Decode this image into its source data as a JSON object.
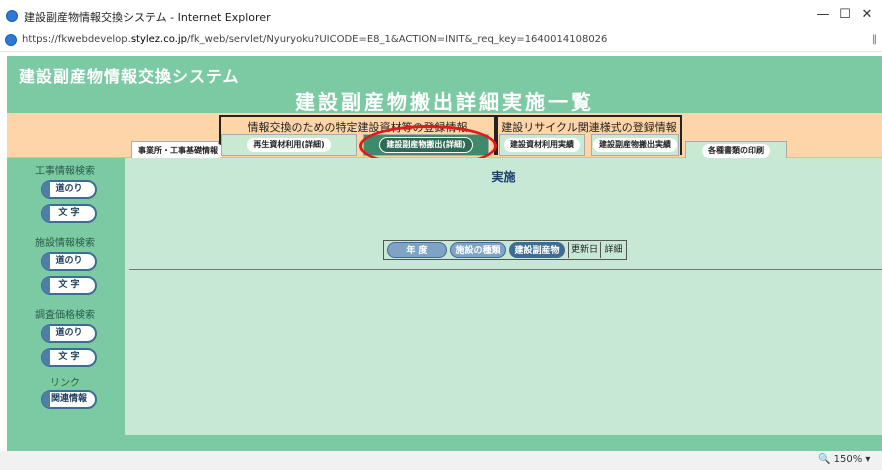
{
  "window": {
    "title": "建設副産物情報交換システム - Internet Explorer",
    "min_glyph": "—",
    "max_glyph": "☐",
    "close_glyph": "✕"
  },
  "address": {
    "scheme": "https://fkwebdevelop.",
    "host": "stylez.co.jp",
    "path": "/fk_web/servlet/Nyuryoku?UICODE=E8_1&ACTION=INIT&_req_key=1640014108026",
    "end_glyph": "‖"
  },
  "app": {
    "system_title": "建設副産物情報交換システム",
    "page_title": "建設副産物搬出詳細実施一覧"
  },
  "menu": {
    "group1_title": "情報交換のための特定建設資材等の登録情報",
    "group2_title": "建設リサイクル関連様式の登録情報",
    "tabs": {
      "jigyo": "事業所・工事基礎情報",
      "saisei": "再生資材利用(詳細)",
      "hanshutsu": "建設副産物搬出(詳細)",
      "shizai": "建設資材利用実績",
      "fukusan": "建設副産物搬出実績",
      "insatsu": "各種書類の印刷"
    }
  },
  "sidebar": {
    "koji_label": "工事情報検索",
    "shisetsu_label": "施設情報検索",
    "chosa_label": "調査価格検索",
    "link_label": "リンク",
    "michinori": "道のり",
    "moji": "文 字",
    "kanren": "関連情報"
  },
  "content": {
    "heading": "実施",
    "cols": {
      "nendo": "年 度",
      "shubetsu": "施設の種類",
      "fukusanbutsu": "建設副産物",
      "koshinbi": "更新日",
      "shosai": "詳細"
    }
  },
  "status": {
    "zoom": "150%"
  }
}
